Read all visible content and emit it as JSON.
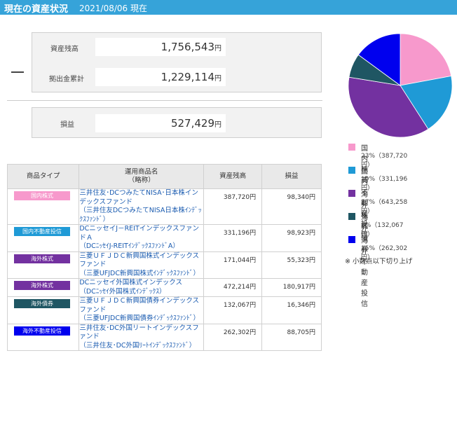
{
  "header": {
    "title": "現在の資産状況",
    "date": "2021/08/06 現在"
  },
  "summary": {
    "assets_label": "資産残高",
    "assets_value": "1,756,543",
    "assets_unit": "円",
    "contrib_label": "拠出金累計",
    "contrib_value": "1,229,114",
    "contrib_unit": "円",
    "minus_sign": "－",
    "profit_label": "損益",
    "profit_value": "527,429",
    "profit_unit": "円"
  },
  "table": {
    "headers": [
      "商品タイプ",
      "運用商品名\n（略称）",
      "資産残高",
      "損益"
    ],
    "rows": [
      {
        "type": "国内株式",
        "type_color": "#f799cc",
        "name": "三井住友･DCつみたてNISA･日本株インデックスファンド",
        "short": "（三井住友DCつみたてNISA日本株ｲﾝﾃﾞｯｸｽﾌｧﾝﾄﾞ）",
        "balance": "387,720円",
        "profit": "98,340円"
      },
      {
        "type": "国内不動産投信",
        "type_color": "#1f9ad6",
        "name": "DCニッセイJ－REITインデックスファンドＡ",
        "short": "（DCﾆｯｾｲJ-REITｲﾝﾃﾞｯｸｽﾌｧﾝﾄﾞA）",
        "balance": "331,196円",
        "profit": "98,923円"
      },
      {
        "type": "海外株式",
        "type_color": "#7331a0",
        "name": "三菱ＵＦＪＤＣ新興国株式インデックスファンド",
        "short": "（三菱UFJDC新興国株式ｲﾝﾃﾞｯｸｽﾌｧﾝﾄﾞ）",
        "balance": "171,044円",
        "profit": "55,323円"
      },
      {
        "type": "海外株式",
        "type_color": "#7331a0",
        "name": "DCニッセイ外国株式インデックス",
        "short": "（DCﾆｯｾｲ外国株式ｲﾝﾃﾞｯｸｽ）",
        "balance": "472,214円",
        "profit": "180,917円"
      },
      {
        "type": "海外債券",
        "type_color": "#1f5663",
        "name": "三菱ＵＦＪＤＣ新興国債券インデックスファンド",
        "short": "（三菱UFJDC新興国債券ｲﾝﾃﾞｯｸｽﾌｧﾝﾄﾞ）",
        "balance": "132,067円",
        "profit": "16,346円"
      },
      {
        "type": "海外不動産投信",
        "type_color": "#0000ee",
        "name": "三井住友･DC外国リートインデックスファンド",
        "short": "（三井住友･DC外国ﾘｰﾄｲﾝﾃﾞｯｸｽﾌｧﾝﾄﾞ）",
        "balance": "262,302円",
        "profit": "88,705円"
      }
    ]
  },
  "chart_data": {
    "type": "pie",
    "categories": [
      "国内株式",
      "国内不動産投信",
      "海外株式",
      "海外債券",
      "海外不動産投信"
    ],
    "values": [
      387720,
      331196,
      643258,
      132067,
      262302
    ],
    "colors": [
      "#f799cc",
      "#1f9ad6",
      "#7331a0",
      "#1f5663",
      "#0000ee"
    ],
    "legend": [
      {
        "name": "国内株式",
        "detail": "23%（387,720円）"
      },
      {
        "name": "国内不動産投信",
        "detail": "19%（331,196円）"
      },
      {
        "name": "海外株式",
        "detail": "37%（643,258円）"
      },
      {
        "name": "海外債券",
        "detail": "8%（132,067円）"
      },
      {
        "name": "海外不動産投信",
        "detail": "15%（262,302円）"
      }
    ],
    "note": "※ 小数点以下切り上げ"
  }
}
